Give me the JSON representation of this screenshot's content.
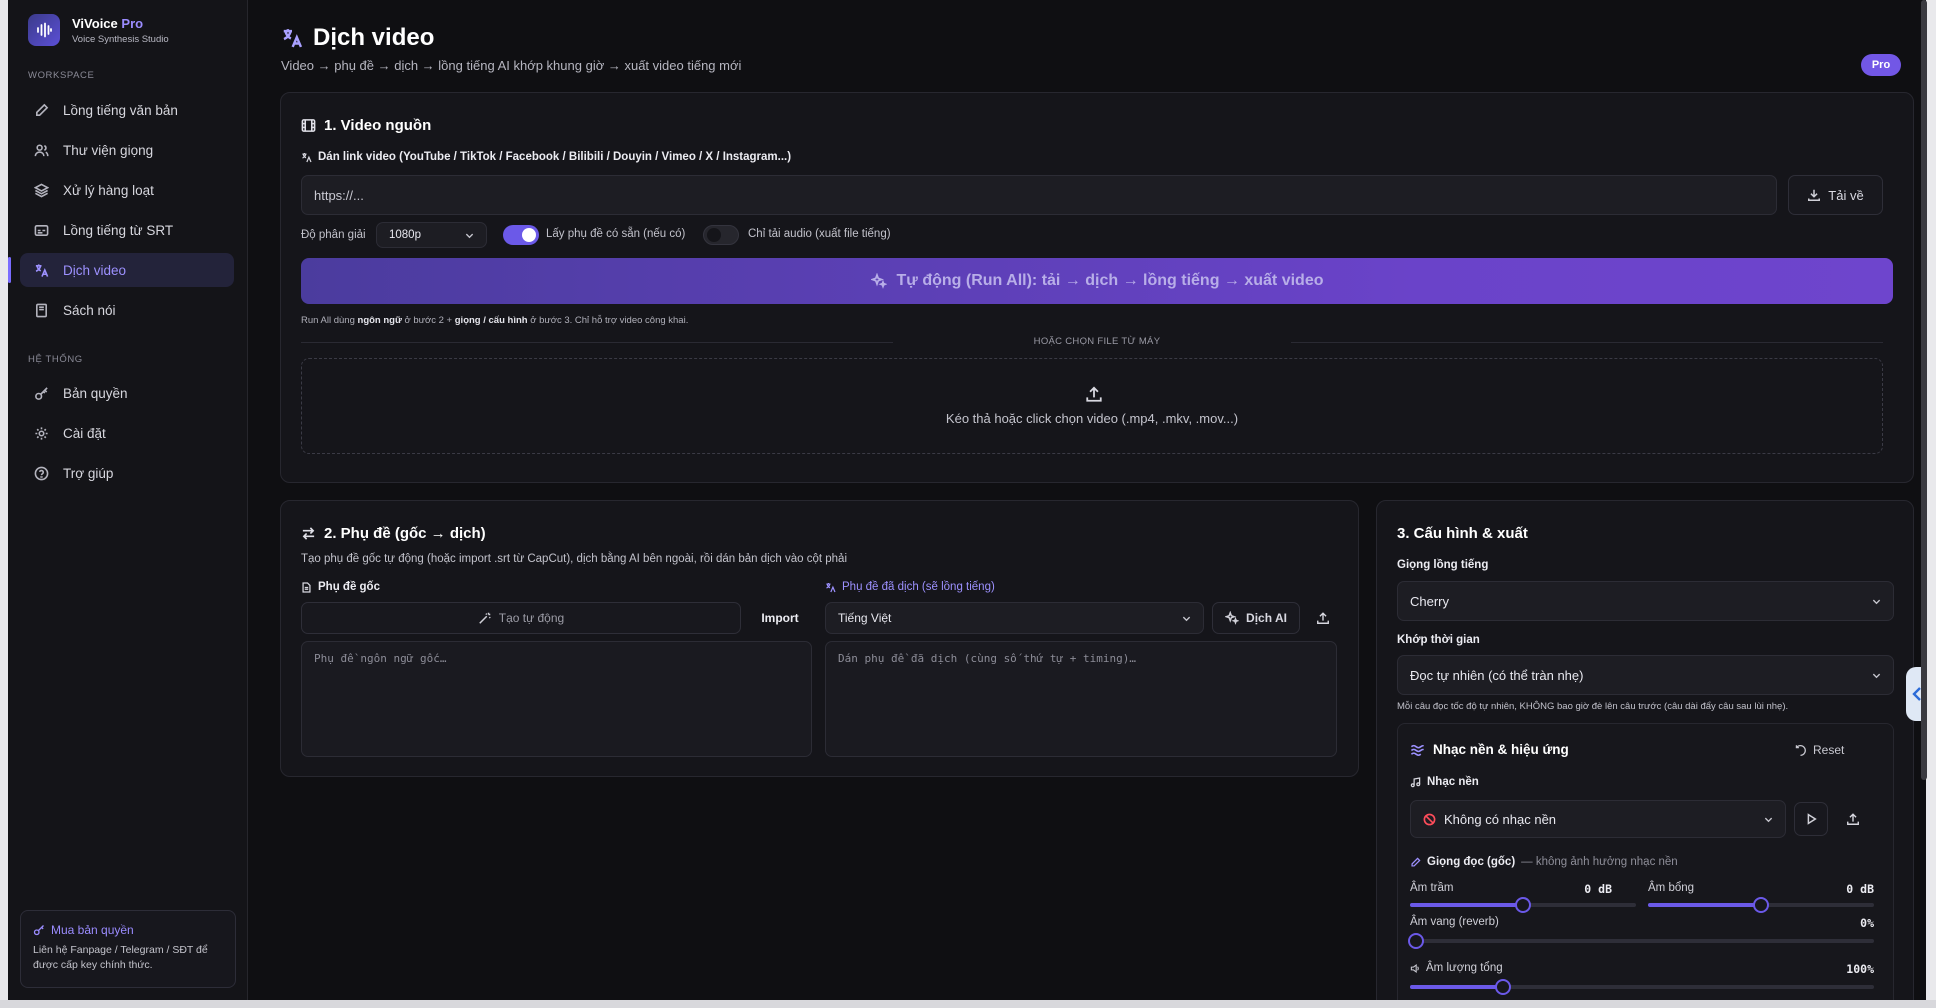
{
  "brand": {
    "name": "ViVoice",
    "name_accent": "Pro",
    "subtitle": "Voice Synthesis Studio"
  },
  "sidebar": {
    "workspace_label": "WORKSPACE",
    "system_label": "HỆ THỐNG",
    "workspace_items": [
      {
        "label": "Lồng tiếng văn bản",
        "icon": "pen-icon"
      },
      {
        "label": "Thư viện giọng",
        "icon": "users-icon"
      },
      {
        "label": "Xử lý hàng loạt",
        "icon": "layers-icon"
      },
      {
        "label": "Lồng tiếng từ SRT",
        "icon": "subtitles-icon"
      },
      {
        "label": "Dịch video",
        "icon": "translate-icon",
        "active": true
      },
      {
        "label": "Sách nói",
        "icon": "book-icon"
      }
    ],
    "system_items": [
      {
        "label": "Bản quyền",
        "icon": "key-icon"
      },
      {
        "label": "Cài đặt",
        "icon": "gear-icon"
      },
      {
        "label": "Trợ giúp",
        "icon": "help-icon"
      }
    ],
    "license_card": {
      "title": "Mua bản quyền",
      "text": "Liên hệ Fanpage / Telegram / SĐT để được cấp key chính thức."
    }
  },
  "header": {
    "title": "Dịch video",
    "subtitle": "Video → phụ đề → dịch → lồng tiếng AI khớp khung giờ → xuất video tiếng mới",
    "badge": "Pro"
  },
  "source": {
    "title": "1. Video nguồn",
    "link_label": "Dán link video (YouTube / TikTok / Facebook / Bilibili / Douyin / Vimeo / X / Instagram...)",
    "url_placeholder": "https://...",
    "download_label": "Tải về",
    "resolution_label": "Độ phân giải",
    "resolution_value": "1080p",
    "subs_toggle_label": "Lấy phụ đề có sẵn (nếu có)",
    "subs_toggle_on": true,
    "audio_toggle_label": "Chỉ tải audio (xuất file tiếng)",
    "audio_toggle_on": false,
    "run_all_label": "Tự động (Run All): tải → dịch → lồng tiếng → xuất video",
    "run_note_1": "Run All dùng ",
    "run_note_bold_1": "ngôn ngữ",
    "run_note_2": " ở bước 2 + ",
    "run_note_bold_2": "giọng / cấu hình",
    "run_note_3": " ở bước 3. Chỉ hỗ trợ video công khai.",
    "or_choose": "HOẶC CHỌN FILE TỪ MÁY",
    "dropzone_text": "Kéo thả hoặc click chọn video (.mp4, .mkv, .mov...)"
  },
  "subtitles": {
    "title": "2. Phụ đề (gốc → dịch)",
    "description": "Tạo phụ đề gốc tự động (hoặc import .srt từ CapCut), dịch bằng AI bên ngoài, rồi dán bản dịch vào cột phải",
    "original_label": "Phụ đề gốc",
    "auto_create_label": "Tạo tự động",
    "import_label": "Import",
    "original_placeholder": "Phụ đề ngôn ngữ gốc…",
    "translated_label": "Phụ đề đã dịch (sẽ lồng tiếng)",
    "language_value": "Tiếng Việt",
    "translate_ai_label": "Dịch AI",
    "translated_placeholder": "Dán phụ đề đã dịch (cùng số thứ tự + timing)…"
  },
  "config": {
    "title": "3. Cấu hình & xuất",
    "voice_label": "Giọng lồng tiếng",
    "voice_value": "Cherry",
    "timing_label": "Khớp thời gian",
    "timing_value": "Đọc tự nhiên (có thể tràn nhẹ)",
    "timing_hint": "Mỗi câu đọc tốc độ tự nhiên, KHÔNG bao giờ đè lên câu trước (câu dài đẩy câu sau lùi nhẹ).",
    "music_title": "Nhạc nền & hiệu ứng",
    "reset_label": "Reset",
    "bg_music_label": "Nhạc nền",
    "bg_music_value": "Không có nhạc nền",
    "voice_fx_label": "Giọng đọc (gốc)",
    "voice_fx_note": "— không ảnh hưởng nhạc nền",
    "bass_label": "Âm trầm",
    "bass_value": "0 dB",
    "bass_fraction": 0.5,
    "treble_label": "Âm bổng",
    "treble_value": "0 dB",
    "treble_fraction": 0.5,
    "reverb_label": "Âm vang (reverb)",
    "reverb_value": "0%",
    "reverb_fraction": 0.0,
    "volume_label": "Âm lượng tổng",
    "volume_value": "100%",
    "volume_fraction": 0.2
  },
  "colors": {
    "accent": "#6b59e8",
    "accent_text": "#9d91ff",
    "background": "#0f0f12"
  }
}
